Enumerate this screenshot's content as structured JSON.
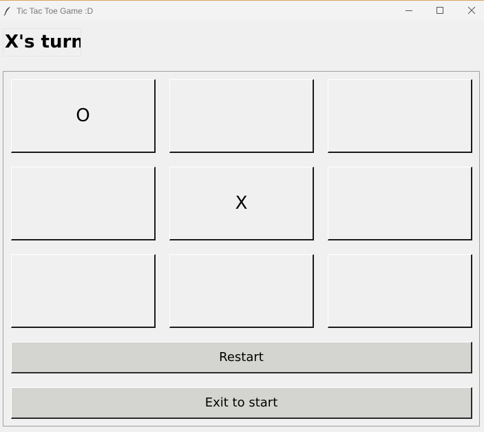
{
  "window": {
    "title": "Tic Tac Toe Game :D",
    "icon": "feather-icon",
    "controls": [
      "minimize-icon",
      "maximize-icon",
      "close-icon"
    ]
  },
  "status": {
    "turn_text": "X's turn"
  },
  "board": {
    "cells": [
      "O",
      "",
      "",
      "",
      "X",
      "",
      "",
      "",
      ""
    ]
  },
  "buttons": {
    "restart_label": "Restart",
    "exit_label": "Exit to start"
  },
  "colors": {
    "window_bg": "#f0f0f0",
    "button_bg": "#d4d5d1",
    "titlebar_bg": "#f3f3f3"
  }
}
